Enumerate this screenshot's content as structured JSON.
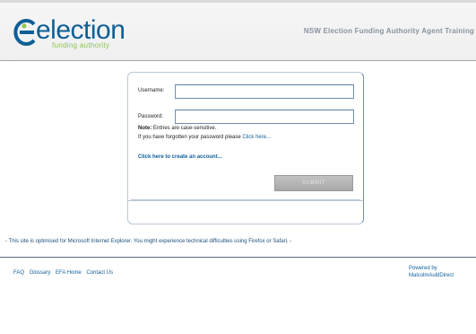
{
  "header": {
    "logo_word": "election",
    "logo_sub": "funding authority",
    "title": "NSW Election Funding Authority Agent Training",
    "brand_color": "#0d5f96",
    "accent_color": "#8cc34b"
  },
  "login": {
    "username_label": "Username:",
    "username_value": "",
    "password_label": "Password:",
    "password_value": "",
    "note_label": "Note:",
    "note_text": " Entries are case-sensitive.",
    "forgot_text": "If you have forgotten your password please ",
    "forgot_link": "Click here...",
    "create_link": "Click here to create an account...",
    "submit_label": "SUBMIT"
  },
  "notice": "- This site is optimised for Microsoft Internet Explorer. You might experience technical difficulties using Firefox or Safari. -",
  "footer": {
    "links": [
      "FAQ",
      "Glossary",
      "EFA Home",
      "Contact Us"
    ],
    "powered_by": "Powered by",
    "powered_name": "MalcolmAuldDirect"
  }
}
